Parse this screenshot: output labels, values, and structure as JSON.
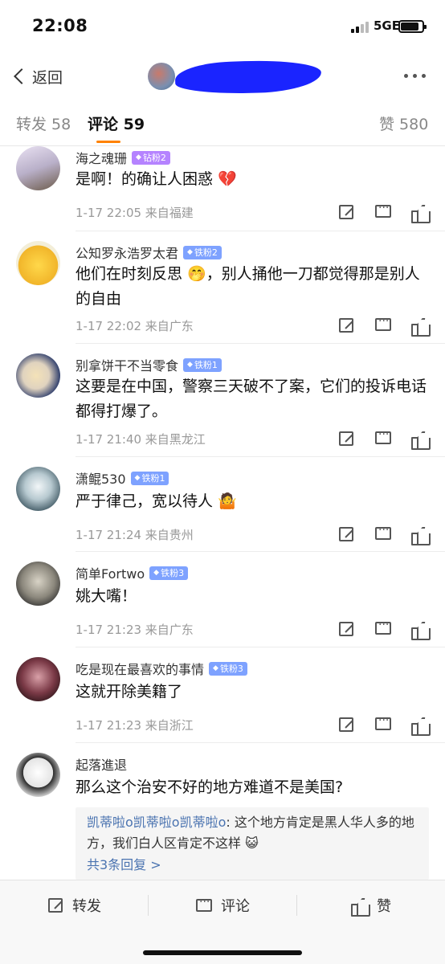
{
  "status_bar": {
    "time": "22:08",
    "network": "5GE"
  },
  "nav": {
    "back_label": "返回"
  },
  "tabs": [
    {
      "label": "转发 58"
    },
    {
      "label": "评论 59"
    },
    {
      "label": "赞 580"
    }
  ],
  "comments": [
    {
      "user": "海之魂珊",
      "badge": "钻粉2",
      "text": "是啊！的确让人困惑 💔",
      "meta": "1-17 22:05  来自福建"
    },
    {
      "user": "公知罗永浩罗太君",
      "badge": "铁粉2",
      "text": "他们在时刻反思 🤭，别人捅他一刀都觉得那是别人的自由",
      "meta": "1-17 22:02  来自广东"
    },
    {
      "user": "别拿饼干不当零食",
      "badge": "铁粉1",
      "text": "这要是在中国，警察三天破不了案，它们的投诉电话都得打爆了。",
      "meta": "1-17 21:40  来自黑龙江"
    },
    {
      "user": "潇鲲530",
      "badge": "铁粉1",
      "text": "严于律己，宽以待人 🤷",
      "meta": "1-17 21:24  来自贵州"
    },
    {
      "user": "简单Fortwo",
      "badge": "铁粉3",
      "text": "姚大嘴！",
      "meta": "1-17 21:23  来自广东"
    },
    {
      "user": "吃是现在最喜欢的事情",
      "badge": "铁粉3",
      "text": "这就开除美籍了",
      "meta": "1-17 21:23  来自浙江"
    },
    {
      "user": "起落進退",
      "badge": "",
      "text": "那么这个治安不好的地方难道不是美国?",
      "meta": ""
    }
  ],
  "reply": {
    "user": "凯蒂啦o凯蒂啦o凯蒂啦o",
    "text": ": 这个地方肯定是黑人华人多的地方，我们白人区肯定不这样 😺",
    "more": "共3条回复 >"
  },
  "toolbar": {
    "forward": "转发",
    "comment": "评论",
    "like": "赞"
  },
  "colors": {
    "accent": "#ff8200",
    "link": "#4a73b0",
    "badge": "#7ea2ff",
    "badge_diamond": "#b583ff"
  }
}
